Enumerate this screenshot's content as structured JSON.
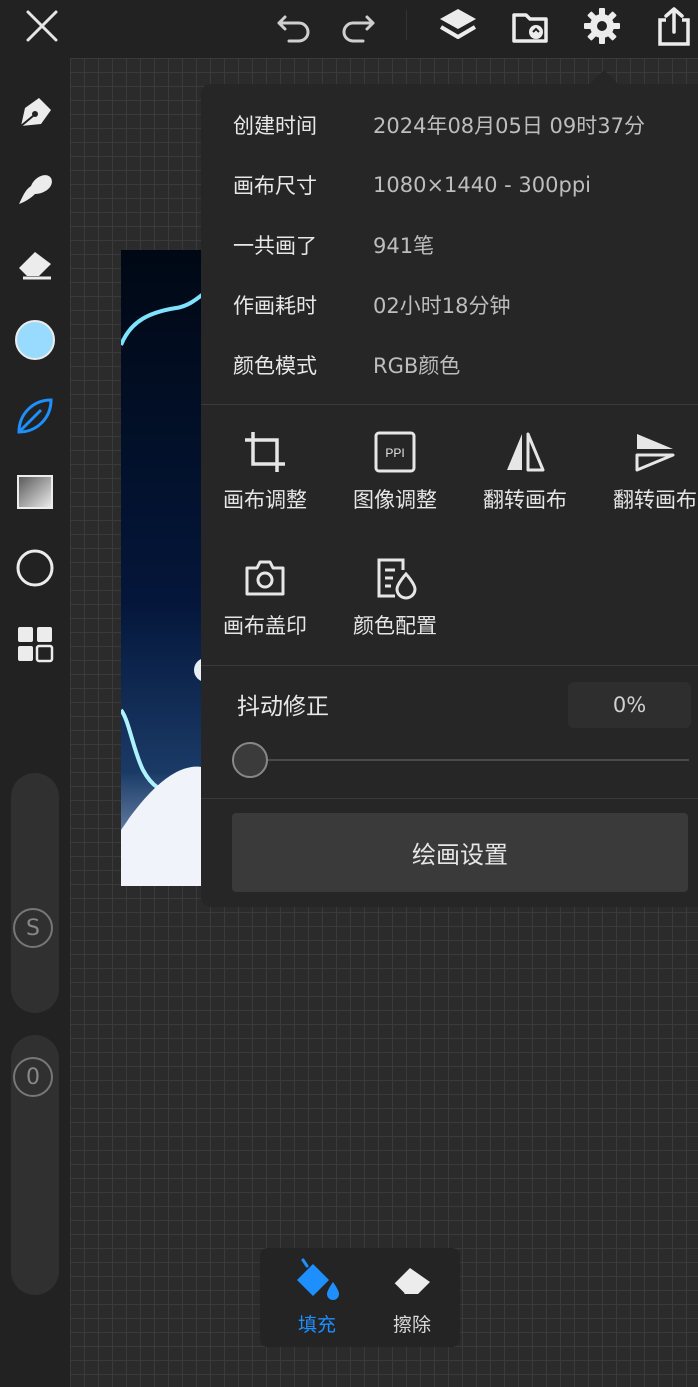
{
  "toolbar": {
    "icons": [
      "close-icon",
      "undo-icon",
      "redo-icon",
      "layers-icon",
      "import-icon",
      "gear-icon",
      "share-icon"
    ]
  },
  "sidebar": {
    "tools": [
      "pen-nib-icon",
      "brush-icon",
      "eraser-icon",
      "color-swatch",
      "leaf-brush-icon",
      "gradient-icon",
      "circle-shape-icon",
      "grid-tools-icon"
    ],
    "current_color": "#99dbff",
    "size_knob_label": "S",
    "opacity_knob_label": "0"
  },
  "info": {
    "rows": [
      {
        "label": "创建时间",
        "value": "2024年08月05日 09时37分"
      },
      {
        "label": "画布尺寸",
        "value": "1080×1440 - 300ppi"
      },
      {
        "label": "一共画了",
        "value": "941笔"
      },
      {
        "label": "作画耗时",
        "value": "02小时18分钟"
      },
      {
        "label": "颜色模式",
        "value": "RGB颜色"
      }
    ]
  },
  "actions": {
    "row1": [
      {
        "label": "画布调整",
        "icon": "crop-icon"
      },
      {
        "label": "图像调整",
        "icon": "ppi-icon"
      },
      {
        "label": "翻转画布",
        "icon": "flip-horizontal-icon"
      },
      {
        "label": "翻转画布",
        "icon": "flip-vertical-icon"
      }
    ],
    "row2": [
      {
        "label": "画布盖印",
        "icon": "camera-icon"
      },
      {
        "label": "颜色配置",
        "icon": "color-profile-icon"
      }
    ]
  },
  "stabilizer": {
    "title": "抖动修正",
    "value_text": "0%",
    "value": 0
  },
  "settings_button": "绘画设置",
  "fill_tools": {
    "fill_label": "填充",
    "erase_label": "擦除",
    "accent": "#1e8fff"
  }
}
